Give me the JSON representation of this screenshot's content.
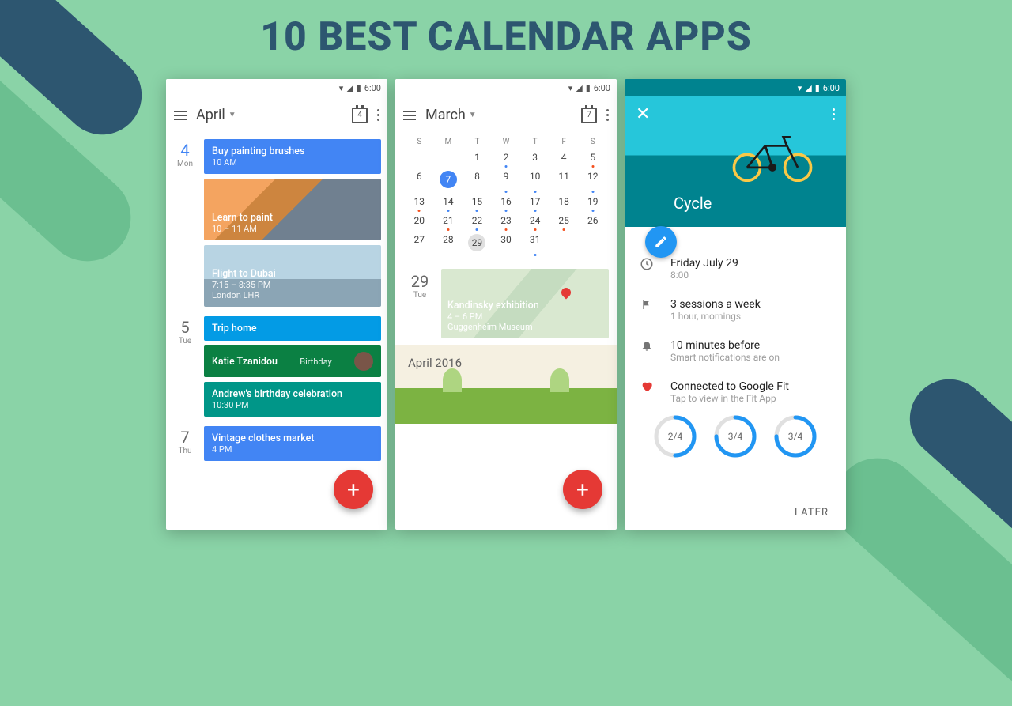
{
  "headline": "10 BEST CALENDAR APPS",
  "status_time": "6:00",
  "phone1": {
    "month": "April",
    "cal_day": "4",
    "days": [
      {
        "num": "4",
        "name": "Mon",
        "blue": true,
        "events": [
          {
            "title": "Buy painting brushes",
            "sub": "10 AM",
            "style": "blue"
          },
          {
            "title": "Learn to paint",
            "sub": "10 – 11 AM",
            "style": "img1"
          },
          {
            "title": "Flight to Dubai",
            "sub": "7:15 – 8:35 PM\nLondon LHR",
            "style": "img2"
          }
        ]
      },
      {
        "num": "5",
        "name": "Tue",
        "events": [
          {
            "title": "Trip home",
            "sub": "",
            "style": "cyan"
          },
          {
            "title": "Katie Tzanidou",
            "sub": "Birthday",
            "style": "green",
            "avatar": true
          },
          {
            "title": "Andrew's birthday celebration",
            "sub": "10:30 PM",
            "style": "teal"
          }
        ]
      },
      {
        "num": "7",
        "name": "Thu",
        "events": [
          {
            "title": "Vintage clothes market",
            "sub": "4 PM",
            "style": "blue"
          }
        ]
      }
    ]
  },
  "phone2": {
    "month": "March",
    "cal_day": "7",
    "dow": [
      "S",
      "M",
      "T",
      "W",
      "T",
      "F",
      "S"
    ],
    "weeks": [
      [
        "",
        "",
        "1",
        "2",
        "3",
        "4",
        "5"
      ],
      [
        "6",
        "7",
        "8",
        "9",
        "10",
        "11",
        "12"
      ],
      [
        "13",
        "14",
        "15",
        "16",
        "17",
        "18",
        "19"
      ],
      [
        "20",
        "21",
        "22",
        "23",
        "24",
        "25",
        "26"
      ],
      [
        "27",
        "28",
        "29",
        "30",
        "31",
        "",
        ""
      ]
    ],
    "selected": "7",
    "today": "29",
    "agenda_day": "29",
    "agenda_dow": "Tue",
    "event": {
      "title": "Kandinsky exhibition",
      "sub": "4 – 6 PM",
      "loc": "Guggenheim Museum"
    },
    "month_banner": "April 2016"
  },
  "phone3": {
    "title": "Cycle",
    "rows": [
      {
        "icon": "clock",
        "l1": "Friday July 29",
        "l2": "8:00"
      },
      {
        "icon": "flag",
        "l1": "3 sessions a week",
        "l2": "1 hour, mornings"
      },
      {
        "icon": "bell",
        "l1": "10 minutes before",
        "l2": "Smart notifications are on"
      },
      {
        "icon": "heart",
        "l1": "Connected to Google Fit",
        "l2": "Tap to view in the Fit App"
      }
    ],
    "rings": [
      "2/4",
      "3/4",
      "3/4"
    ],
    "later": "LATER"
  }
}
